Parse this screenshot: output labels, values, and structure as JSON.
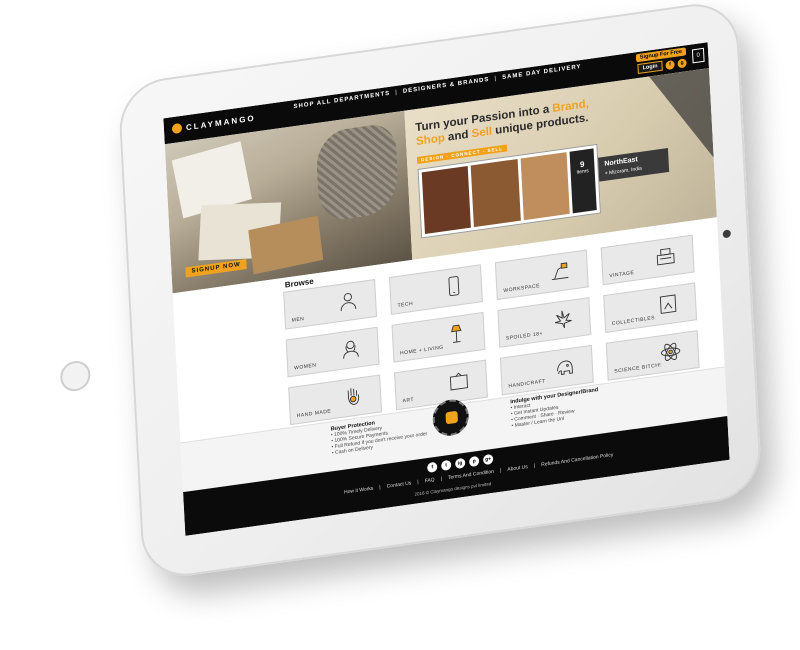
{
  "header": {
    "logo": "CLAYMANGO",
    "nav": [
      "SHOP ALL DEPARTMENTS",
      "DESIGNERS & BRANDS",
      "SAME DAY DELIVERY"
    ],
    "signup": "Signup For Free",
    "login": "Login",
    "social": [
      "f",
      "g"
    ],
    "cart_count": "0"
  },
  "hero": {
    "signup_now": "SIGNUP NOW",
    "headline_1": "Turn your Passion into a ",
    "headline_brand": "Brand,",
    "headline_shop": "Shop",
    "headline_and": " and ",
    "headline_sell": "Sell",
    "headline_rest": " unique products.",
    "tagline": "DESIGN · CONNECT · SELL",
    "count": "9",
    "count_label": "Items",
    "region_name": "NorthEast",
    "region_location": "Mizoram, India",
    "region_tag": "NORTH EAST"
  },
  "browse": {
    "title": "Browse",
    "tiles": [
      {
        "label": "MEN",
        "icon": "man-icon"
      },
      {
        "label": "TECH",
        "icon": "phone-icon"
      },
      {
        "label": "WORKSPACE",
        "icon": "lamp-icon"
      },
      {
        "label": "VINTAGE",
        "icon": "typewriter-icon"
      },
      {
        "label": "WOMEN",
        "icon": "woman-icon"
      },
      {
        "label": "HOME + LIVING",
        "icon": "floor-lamp-icon"
      },
      {
        "label": "SPOILED 18+",
        "icon": "leaf-icon"
      },
      {
        "label": "COLLECTIBLES",
        "icon": "frame-icon"
      },
      {
        "label": "HAND MADE",
        "icon": "hand-icon"
      },
      {
        "label": "ART",
        "icon": "picture-frame-icon"
      },
      {
        "label": "HANDICRAFT",
        "icon": "elephant-icon"
      },
      {
        "label": "SCIENCE BITCH!",
        "icon": "atom-icon"
      }
    ]
  },
  "info": {
    "buyer_title": "Buyer Protection",
    "buyer_items": [
      "100% Timely Delivery",
      "100% Secure Payments",
      "Full Refund if you don't receive your order",
      "Cash on Delivery"
    ],
    "indulge_title": "Indulge with your Designer/Brand",
    "indulge_items": [
      "Interact",
      "Get Instant Updates",
      "Comment · Share · Review",
      "Master / Learn the Unl"
    ]
  },
  "footer": {
    "social": [
      "f",
      "t",
      "ig",
      "p",
      "g+"
    ],
    "links": [
      "How it Works",
      "Contact Us",
      "FAQ",
      "Terms And Condition",
      "About Us",
      "Refunds And Cancellation Policy"
    ],
    "copyright": "2016 © Claymango designs pvt limited"
  }
}
